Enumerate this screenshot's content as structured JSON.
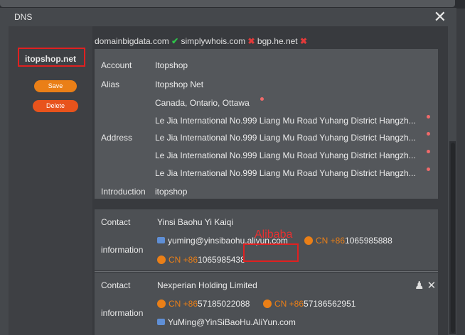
{
  "window": {
    "title": "DNS",
    "close": "✕"
  },
  "sidebar": {
    "domain": "itopshop.net",
    "save_label": "Save",
    "delete_label": "Delete"
  },
  "sources": [
    {
      "name": "domainbigdata.com",
      "status": "✔"
    },
    {
      "name": "simplywhois.com",
      "status": "✖"
    },
    {
      "name": "bgp.he.net",
      "status": "✖"
    }
  ],
  "info": {
    "account_label": "Account",
    "account_value": "Itopshop",
    "alias_label": "Alias",
    "alias_value": "Itopshop Net",
    "address_label": "Address",
    "address_lines": [
      "Canada, Ontario, Ottawa",
      "Le Jia International No.999 Liang Mu Road Yuhang District Hangzh...",
      "Le Jia International No.999 Liang Mu Road Yuhang District Hangzh...",
      "Le Jia International No.999 Liang Mu Road Yuhang District Hangzh...",
      "Le Jia International No.999 Liang Mu Road Yuhang District Hangzh..."
    ],
    "introduction_label": "Introduction",
    "introduction_value": "itopshop"
  },
  "contacts": [
    {
      "contact_label": "Contact",
      "info_label": "information",
      "name": "Yinsi Baohu Yi Kaiqi",
      "email": "yuming@yinsibaohu.aliyun.com",
      "phones": [
        {
          "cc": "CN +86",
          "num": "1065985888"
        },
        {
          "cc": "CN +86",
          "num": "1065985438"
        }
      ],
      "annotation": "Alibaba"
    },
    {
      "contact_label": "Contact",
      "info_label": "information",
      "name": "Nexperian Holding Limited",
      "phones": [
        {
          "cc": "CN +86",
          "num": "57185022088"
        },
        {
          "cc": "CN +86",
          "num": "57186562951"
        }
      ],
      "email": "YuMing@YinSiBaoHu.AliYun.com"
    }
  ],
  "colors": {
    "accent": "#ea7f17",
    "delete": "#e8531c",
    "ok": "#2ec44a",
    "bad": "#e23a3a",
    "annotation": "#e02020"
  },
  "icons": {
    "close": "close-icon",
    "mail": "mail-icon",
    "phone": "phone-icon",
    "add_contact": "add-contact-icon"
  }
}
